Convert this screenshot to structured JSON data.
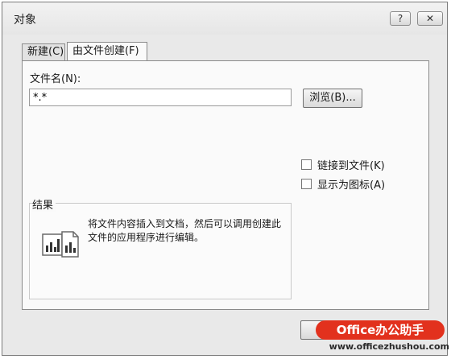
{
  "window": {
    "title": "对象",
    "help_label": "?",
    "close_label": "✕"
  },
  "tabs": [
    {
      "label": "新建(C)",
      "selected": false
    },
    {
      "label": "由文件创建(F)",
      "selected": true
    }
  ],
  "file": {
    "label": "文件名(N):",
    "value": "*.*",
    "browse_label": "浏览(B)..."
  },
  "options": {
    "link_label": "链接到文件(K)",
    "link_checked": false,
    "icon_label": "显示为图标(A)",
    "icon_checked": false
  },
  "result": {
    "label": "结果",
    "text": "将文件内容插入到文档，然后可以调用创建此文件的应用程序进行编辑。"
  },
  "watermark": {
    "brand": "Office办公助手",
    "url": "www.officezhushou.com",
    "color": "#e2311d"
  }
}
